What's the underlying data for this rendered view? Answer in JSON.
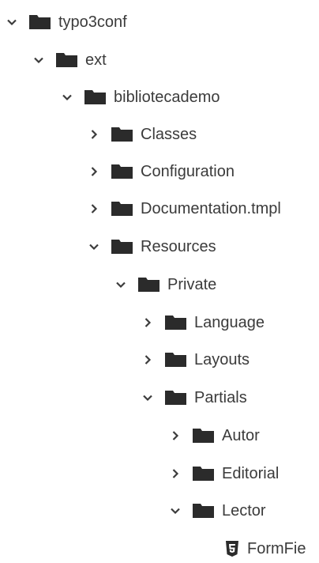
{
  "tree": {
    "nodes": [
      {
        "label": "typo3conf",
        "expanded": true,
        "type": "folder"
      },
      {
        "label": "ext",
        "expanded": true,
        "type": "folder"
      },
      {
        "label": "bibliotecademo",
        "expanded": true,
        "type": "folder"
      },
      {
        "label": "Classes",
        "expanded": false,
        "type": "folder"
      },
      {
        "label": "Configuration",
        "expanded": false,
        "type": "folder"
      },
      {
        "label": "Documentation.tmpl",
        "expanded": false,
        "type": "folder"
      },
      {
        "label": "Resources",
        "expanded": true,
        "type": "folder"
      },
      {
        "label": "Private",
        "expanded": true,
        "type": "folder"
      },
      {
        "label": "Language",
        "expanded": false,
        "type": "folder"
      },
      {
        "label": "Layouts",
        "expanded": false,
        "type": "folder"
      },
      {
        "label": "Partials",
        "expanded": true,
        "type": "folder"
      },
      {
        "label": "Autor",
        "expanded": false,
        "type": "folder"
      },
      {
        "label": "Editorial",
        "expanded": false,
        "type": "folder"
      },
      {
        "label": "Lector",
        "expanded": true,
        "type": "folder"
      },
      {
        "label": "FormFie",
        "type": "html5-file"
      }
    ]
  },
  "colors": {
    "text": "#3b3b3b",
    "folder": "#2b2b2b",
    "chevron": "#3b3b3b",
    "background": "#ffffff"
  },
  "icons": {
    "expanded": "chevron-down-icon",
    "collapsed": "chevron-right-icon",
    "folder": "folder-icon",
    "file": "html5-file-icon"
  }
}
